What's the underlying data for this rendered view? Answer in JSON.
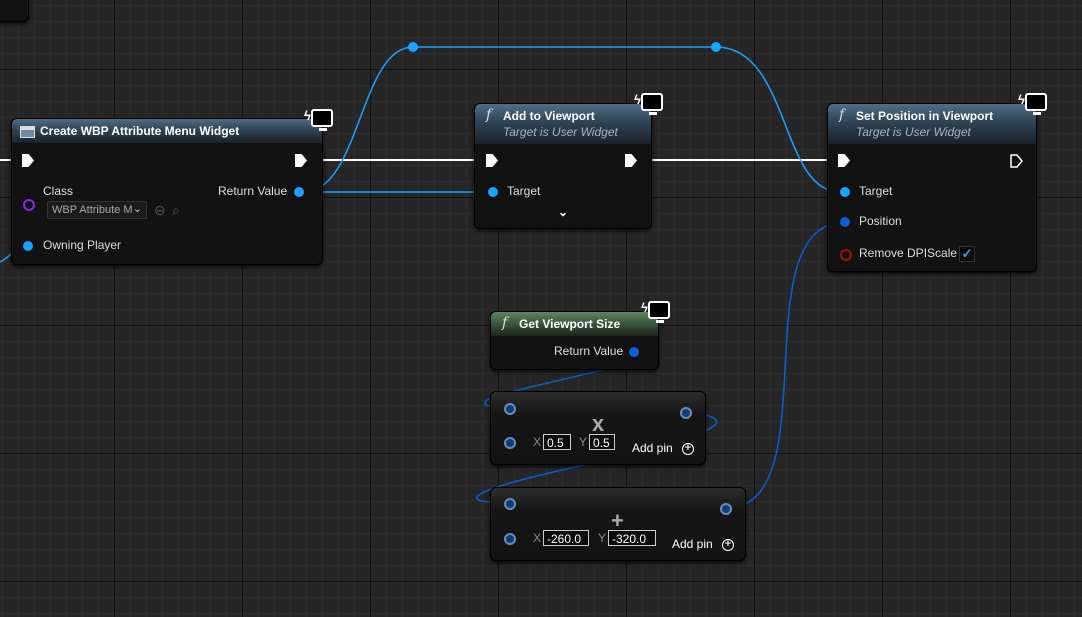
{
  "nodes": {
    "create_widget": {
      "title": "Create WBP Attribute Menu Widget",
      "class_label": "Class",
      "class_value": "WBP Attribute M",
      "return_value_label": "Return Value",
      "owning_player_label": "Owning Player"
    },
    "add_to_viewport": {
      "title": "Add to Viewport",
      "subtitle": "Target is User Widget",
      "target_label": "Target"
    },
    "set_position": {
      "title": "Set Position in Viewport",
      "subtitle": "Target is User Widget",
      "target_label": "Target",
      "position_label": "Position",
      "remove_dpi_label": "Remove DPIScale",
      "remove_dpi_checked": true
    },
    "get_viewport_size": {
      "title": "Get Viewport Size",
      "return_value_label": "Return Value"
    },
    "multiply": {
      "operator": "x",
      "x_axis": "X",
      "x_value": "0.5",
      "y_axis": "Y",
      "y_value": "0.5",
      "add_pin_label": "Add pin"
    },
    "add": {
      "operator": "+",
      "x_axis": "X",
      "x_value": "-260.0",
      "y_axis": "Y",
      "y_value": "-320.0",
      "add_pin_label": "Add pin"
    }
  },
  "icons": {
    "function": "f",
    "plus": "+",
    "checkmark": "✓",
    "chevron_down": "⌄",
    "bolt": "ϟ",
    "reset": "⊖",
    "search": "⌕"
  },
  "colors": {
    "object_pin": "#1ba1ff",
    "struct_pin": "#0b5fcf",
    "class_pin": "#8a2be2",
    "bool_pin": "#a01010",
    "exec_wire": "#ffffff",
    "function_header": "#4f6e86",
    "pure_header": "#5f8561"
  }
}
